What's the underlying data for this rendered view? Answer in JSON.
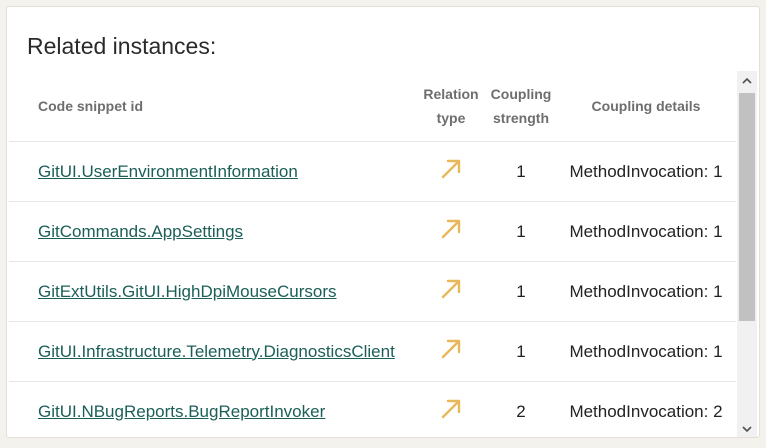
{
  "panel": {
    "title": "Related instances:"
  },
  "table": {
    "headers": {
      "snippet_id": "Code snippet id",
      "relation_type": "Relation type",
      "coupling_strength": "Coupling strength",
      "coupling_details": "Coupling details"
    },
    "rows": [
      {
        "id": "GitUI.UserEnvironmentInformation",
        "relation_icon": "arrow-up-right-icon",
        "strength": "1",
        "details": "MethodInvocation: 1"
      },
      {
        "id": "GitCommands.AppSettings",
        "relation_icon": "arrow-up-right-icon",
        "strength": "1",
        "details": "MethodInvocation: 1"
      },
      {
        "id": "GitExtUtils.GitUI.HighDpiMouseCursors",
        "relation_icon": "arrow-up-right-icon",
        "strength": "1",
        "details": "MethodInvocation: 1"
      },
      {
        "id": "GitUI.Infrastructure.Telemetry.DiagnosticsClient",
        "relation_icon": "arrow-up-right-icon",
        "strength": "1",
        "details": "MethodInvocation: 1"
      },
      {
        "id": "GitUI.NBugReports.BugReportInvoker",
        "relation_icon": "arrow-up-right-icon",
        "strength": "2",
        "details": "MethodInvocation: 2"
      }
    ]
  },
  "colors": {
    "link": "#1b5f58",
    "arrow": "#e8b85a",
    "scroll_thumb": "#c1c1c1"
  }
}
